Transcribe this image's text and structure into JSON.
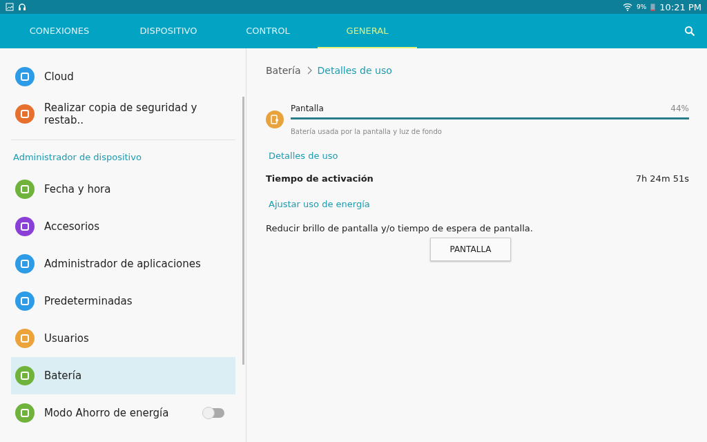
{
  "status_bar": {
    "battery_percent": "9%",
    "time": "10:21 PM"
  },
  "tabs": [
    {
      "label": "CONEXIONES",
      "selected": false
    },
    {
      "label": "DISPOSITIVO",
      "selected": false
    },
    {
      "label": "CONTROL",
      "selected": false
    },
    {
      "label": "GENERAL",
      "selected": true
    }
  ],
  "sidebar": {
    "items": [
      {
        "kind": "item",
        "label": "Cloud",
        "color": "#2d9be6",
        "selected": false
      },
      {
        "kind": "item",
        "label": "Realizar copia de seguridad y restab..",
        "color": "#e8702e",
        "selected": false
      },
      {
        "kind": "header",
        "label": "Administrador de dispositivo"
      },
      {
        "kind": "item",
        "label": "Fecha y hora",
        "color": "#6fb33c",
        "selected": false
      },
      {
        "kind": "item",
        "label": "Accesorios",
        "color": "#8a3fd6",
        "selected": false
      },
      {
        "kind": "item",
        "label": "Administrador de aplicaciones",
        "color": "#2d9be6",
        "selected": false
      },
      {
        "kind": "item",
        "label": "Predeterminadas",
        "color": "#2d9be6",
        "selected": false
      },
      {
        "kind": "item",
        "label": "Usuarios",
        "color": "#eba33a",
        "selected": false
      },
      {
        "kind": "item",
        "label": "Batería",
        "color": "#6fb33c",
        "selected": true
      },
      {
        "kind": "toggle",
        "label": "Modo Ahorro de energía",
        "color": "#6fb33c",
        "selected": false,
        "on": false
      }
    ]
  },
  "breadcrumb": {
    "parent": "Batería",
    "current": "Detalles de uso"
  },
  "usage": {
    "name": "Pantalla",
    "percent": "44%",
    "level": 1,
    "description": "Batería usada por la pantalla y luz de fondo"
  },
  "details": {
    "heading": "Detalles de uso",
    "label": "Tiempo de activación",
    "value": "7h 24m 51s"
  },
  "adjust": {
    "heading": "Ajustar uso de energía",
    "text": "Reducir brillo de pantalla y/o tiempo de espera de pantalla.",
    "button": "PANTALLA"
  }
}
